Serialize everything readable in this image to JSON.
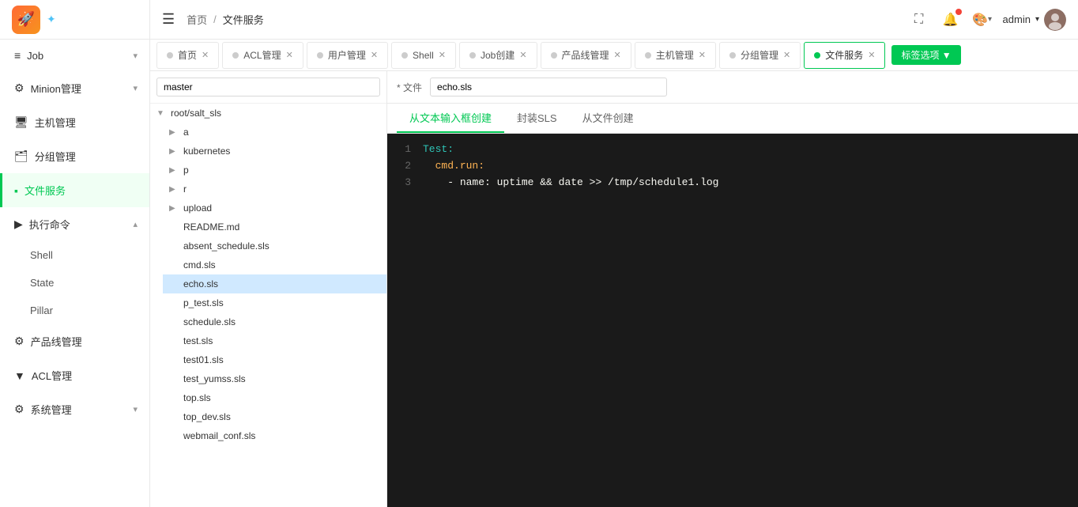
{
  "logo": {
    "icon": "🚀",
    "star": "✦"
  },
  "sidebar": {
    "items": [
      {
        "id": "job",
        "label": "Job",
        "icon": "≡",
        "hasArrow": true,
        "active": false
      },
      {
        "id": "minion",
        "label": "Minion管理",
        "icon": "⚙",
        "hasArrow": true,
        "active": false
      },
      {
        "id": "host",
        "label": "主机管理",
        "icon": "🖥",
        "hasArrow": false,
        "active": false
      },
      {
        "id": "group",
        "label": "分组管理",
        "icon": "🗂",
        "hasArrow": false,
        "active": false
      },
      {
        "id": "file",
        "label": "文件服务",
        "icon": "📄",
        "hasArrow": false,
        "active": true
      },
      {
        "id": "exec",
        "label": "执行命令",
        "icon": "▶",
        "hasArrow": true,
        "active": false
      }
    ],
    "subItems": [
      {
        "id": "shell",
        "label": "Shell",
        "active": false
      },
      {
        "id": "state",
        "label": "State",
        "active": false
      },
      {
        "id": "pillar",
        "label": "Pillar",
        "active": false
      }
    ],
    "bottomItems": [
      {
        "id": "product",
        "label": "产品线管理",
        "icon": "⚙"
      },
      {
        "id": "acl",
        "label": "ACL管理",
        "icon": "▼"
      },
      {
        "id": "system",
        "label": "系统管理",
        "icon": "⚙",
        "hasArrow": true
      }
    ]
  },
  "header": {
    "breadcrumb_home": "首页",
    "breadcrumb_sep": "/",
    "breadcrumb_current": "文件服务",
    "user": "admin",
    "expand_icon": "⛶",
    "bell_icon": "🔔",
    "paint_icon": "🎨"
  },
  "tabs": [
    {
      "id": "home",
      "label": "首页",
      "dot": "gray",
      "closable": true
    },
    {
      "id": "acl",
      "label": "ACL管理",
      "dot": "gray",
      "closable": true
    },
    {
      "id": "user",
      "label": "用户管理",
      "dot": "gray",
      "closable": true
    },
    {
      "id": "shell",
      "label": "Shell",
      "dot": "gray",
      "closable": true
    },
    {
      "id": "job-create",
      "label": "Job创建",
      "dot": "gray",
      "closable": true
    },
    {
      "id": "product-line",
      "label": "产品线管理",
      "dot": "gray",
      "closable": true
    },
    {
      "id": "host-mgmt",
      "label": "主机管理",
      "dot": "gray",
      "closable": true
    },
    {
      "id": "group-mgmt",
      "label": "分组管理",
      "dot": "gray",
      "closable": true
    },
    {
      "id": "file-svc",
      "label": "文件服务",
      "dot": "green",
      "closable": true,
      "active": true
    }
  ],
  "tab_add_label": "标签选项 ▼",
  "file_tree": {
    "search_placeholder": "master",
    "root": "root/salt_sls",
    "folders": [
      "a",
      "kubernetes",
      "p",
      "r",
      "upload"
    ],
    "files": [
      "README.md",
      "absent_schedule.sls",
      "cmd.sls",
      "echo.sls",
      "p_test.sls",
      "schedule.sls",
      "test.sls",
      "test01.sls",
      "test_yumss.sls",
      "top.sls",
      "top_dev.sls",
      "webmail_conf.sls"
    ],
    "selected_file": "echo.sls"
  },
  "editor": {
    "label": "* 文件",
    "filename_value": "echo.sls",
    "tabs": [
      {
        "id": "text-create",
        "label": "从文本输入框创建",
        "active": true
      },
      {
        "id": "wrap-sls",
        "label": "封装SLS",
        "active": false
      },
      {
        "id": "file-create",
        "label": "从文件创建",
        "active": false
      }
    ],
    "code_lines": [
      {
        "num": "1",
        "content": "Test:"
      },
      {
        "num": "2",
        "content": "  cmd.run:"
      },
      {
        "num": "3",
        "content": "    - name: uptime && date >> /tmp/schedule1.log"
      }
    ]
  }
}
